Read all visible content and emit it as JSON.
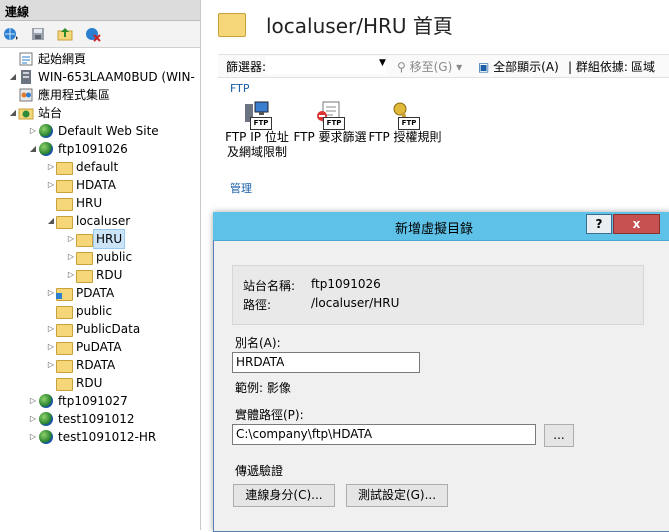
{
  "left_pane": {
    "header": "連線",
    "tree": [
      {
        "label": "起始網頁",
        "icon": "start-page-icon",
        "indent": 0,
        "expander": ""
      },
      {
        "label": "WIN-653LAAM0BUD (WIN-",
        "icon": "server-icon",
        "indent": 0,
        "expander": "◢"
      },
      {
        "label": "應用程式集區",
        "icon": "app-pools-icon",
        "indent": 1,
        "expander": ""
      },
      {
        "label": "站台",
        "icon": "sites-icon",
        "indent": 1,
        "expander": "◢"
      },
      {
        "label": "Default Web Site",
        "icon": "globe-icon",
        "indent": 2,
        "expander": "▷"
      },
      {
        "label": "ftp1091026",
        "icon": "globe-icon",
        "indent": 2,
        "expander": "◢"
      },
      {
        "label": "default",
        "icon": "folder-icon",
        "indent": 3,
        "expander": "▷"
      },
      {
        "label": "HDATA",
        "icon": "folder-icon",
        "indent": 3,
        "expander": "▷"
      },
      {
        "label": "HRU",
        "icon": "folder-icon",
        "indent": 3,
        "expander": ""
      },
      {
        "label": "localuser",
        "icon": "folder-icon",
        "indent": 3,
        "expander": "◢"
      },
      {
        "label": "HRU",
        "icon": "folder-icon",
        "indent": 4,
        "expander": "▷",
        "selected": true
      },
      {
        "label": "public",
        "icon": "folder-icon",
        "indent": 4,
        "expander": "▷"
      },
      {
        "label": "RDU",
        "icon": "folder-icon",
        "indent": 4,
        "expander": "▷"
      },
      {
        "label": "PDATA",
        "icon": "virtual-dir-icon",
        "indent": 3,
        "expander": "▷"
      },
      {
        "label": "public",
        "icon": "folder-icon",
        "indent": 3,
        "expander": ""
      },
      {
        "label": "PublicData",
        "icon": "folder-icon",
        "indent": 3,
        "expander": "▷"
      },
      {
        "label": "PuDATA",
        "icon": "folder-icon",
        "indent": 3,
        "expander": "▷"
      },
      {
        "label": "RDATA",
        "icon": "folder-icon",
        "indent": 3,
        "expander": "▷"
      },
      {
        "label": "RDU",
        "icon": "folder-icon",
        "indent": 3,
        "expander": ""
      },
      {
        "label": "ftp1091027",
        "icon": "globe-icon",
        "indent": 2,
        "expander": "▷"
      },
      {
        "label": "test1091012",
        "icon": "globe-icon",
        "indent": 2,
        "expander": "▷"
      },
      {
        "label": "test1091012-HR",
        "icon": "globe-icon",
        "indent": 2,
        "expander": "▷"
      }
    ]
  },
  "main": {
    "title": "localuser/HRU 首頁",
    "filter_label": "篩選器:",
    "move_to": "移至(G)",
    "show_all": "全部顯示(A)",
    "group_by": "| 群組依據:",
    "group_value": "區域",
    "section_ftp": "FTP",
    "section_manage": "管理",
    "features": [
      {
        "label_line1": "FTP IP 位址",
        "label_line2": "及網域限制"
      },
      {
        "label_line1": "FTP 要求篩選",
        "label_line2": ""
      },
      {
        "label_line1": "FTP 授權規則",
        "label_line2": ""
      }
    ]
  },
  "dialog": {
    "title": "新增虛擬目錄",
    "help": "?",
    "close": "x",
    "site_name_label": "站台名稱:",
    "site_name_value": "ftp1091026",
    "path_label": "路徑:",
    "path_value": "/localuser/HRU",
    "alias_label": "別名(A):",
    "alias_value": "HRDATA",
    "example": "範例: 影像",
    "physical_path_label": "實體路徑(P):",
    "physical_path_value": "C:\\company\\ftp\\HDATA",
    "browse": "...",
    "pass_through_label": "傳遞驗證",
    "connect_as": "連線身分(C)...",
    "test_settings": "測試設定(G)..."
  }
}
